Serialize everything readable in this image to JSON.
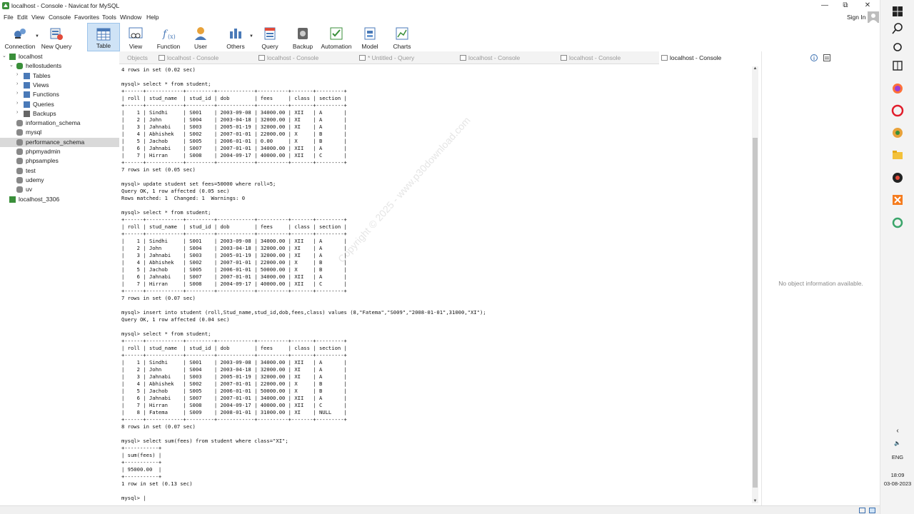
{
  "window": {
    "title": "localhost - Console - Navicat for MySQL"
  },
  "menu": {
    "items": [
      "File",
      "Edit",
      "View",
      "Console",
      "Favorites",
      "Tools",
      "Window",
      "Help"
    ],
    "sign_in": "Sign In"
  },
  "toolbar": {
    "items": [
      "Connection",
      "New Query",
      "Table",
      "View",
      "Function",
      "User",
      "Others",
      "Query",
      "Backup",
      "Automation",
      "Model",
      "Charts"
    ],
    "active": "Table"
  },
  "sidebar": {
    "items": [
      {
        "label": "localhost",
        "icon": "connection-icon"
      },
      {
        "label": "hellostudents",
        "icon": "database-icon"
      },
      {
        "label": "Tables",
        "icon": "table-icon"
      },
      {
        "label": "Views",
        "icon": "view-icon"
      },
      {
        "label": "Functions",
        "icon": "function-icon"
      },
      {
        "label": "Queries",
        "icon": "query-icon"
      },
      {
        "label": "Backups",
        "icon": "backup-icon"
      },
      {
        "label": "information_schema",
        "icon": "database-icon"
      },
      {
        "label": "mysql",
        "icon": "database-icon"
      },
      {
        "label": "performance_schema",
        "icon": "database-icon"
      },
      {
        "label": "phpmyadmin",
        "icon": "database-icon"
      },
      {
        "label": "phpsamples",
        "icon": "database-icon"
      },
      {
        "label": "test",
        "icon": "database-icon"
      },
      {
        "label": "udemy",
        "icon": "database-icon"
      },
      {
        "label": "uv",
        "icon": "database-icon"
      },
      {
        "label": "localhost_3306",
        "icon": "connection-icon"
      }
    ],
    "selected": "performance_schema"
  },
  "tabs": [
    "Objects",
    "localhost - Console",
    "localhost - Console",
    "* Untitled - Query",
    "localhost - Console",
    "localhost - Console",
    "localhost - Console"
  ],
  "console": {
    "text": "4 rows in set (0.02 sec)\n\nmysql> select * from student;\n+------+------------+---------+------------+----------+-------+---------+\n| roll | stud_name  | stud_id | dob        | fees     | class | section |\n+------+------------+---------+------------+----------+-------+---------+\n|    1 | Sindhi     | S001    | 2003-09-08 | 34000.00 | XII   | A       |\n|    2 | John       | S004    | 2003-04-18 | 32000.00 | XI    | A       |\n|    3 | Jahnabi    | S003    | 2005-01-19 | 32000.00 | XI    | A       |\n|    4 | Abhishek   | S002    | 2007-01-01 | 22000.00 | X     | B       |\n|    5 | Jachob     | S005    | 2006-01-01 | 0.00     | X     | B       |\n|    6 | Jahnabi    | S007    | 2007-01-01 | 34000.00 | XII   | A       |\n|    7 | Hirran     | S008    | 2004-09-17 | 40000.00 | XII   | C       |\n+------+------------+---------+------------+----------+-------+---------+\n7 rows in set (0.05 sec)\n\nmysql> update student set fees=50000 where roll=5;\nQuery OK, 1 row affected (0.05 sec)\nRows matched: 1  Changed: 1  Warnings: 0\n\nmysql> select * from student;\n+------+------------+---------+------------+----------+-------+---------+\n| roll | stud_name  | stud_id | dob        | fees     | class | section |\n+------+------------+---------+------------+----------+-------+---------+\n|    1 | Sindhi     | S001    | 2003-09-08 | 34000.00 | XII   | A       |\n|    2 | John       | S004    | 2003-04-18 | 32000.00 | XI    | A       |\n|    3 | Jahnabi    | S003    | 2005-01-19 | 32000.00 | XI    | A       |\n|    4 | Abhishek   | S002    | 2007-01-01 | 22000.00 | X     | B       |\n|    5 | Jachob     | S005    | 2006-01-01 | 50000.00 | X     | B       |\n|    6 | Jahnabi    | S007    | 2007-01-01 | 34000.00 | XII   | A       |\n|    7 | Hirran     | S008    | 2004-09-17 | 40000.00 | XII   | C       |\n+------+------------+---------+------------+----------+-------+---------+\n7 rows in set (0.07 sec)\n\nmysql> insert into student (roll,Stud_name,stud_id,dob,fees,class) values (8,\"Fatema\",\"S009\",\"2008-01-01\",31000,\"XI\");\nQuery OK, 1 row affected (0.04 sec)\n\nmysql> select * from student;\n+------+------------+---------+------------+----------+-------+---------+\n| roll | stud_name  | stud_id | dob        | fees     | class | section |\n+------+------------+---------+------------+----------+-------+---------+\n|    1 | Sindhi     | S001    | 2003-09-08 | 34000.00 | XII   | A       |\n|    2 | John       | S004    | 2003-04-18 | 32000.00 | XI    | A       |\n|    3 | Jahnabi    | S003    | 2005-01-19 | 32000.00 | XI    | A       |\n|    4 | Abhishek   | S002    | 2007-01-01 | 22000.00 | X     | B       |\n|    5 | Jachob     | S005    | 2006-01-01 | 50000.00 | X     | B       |\n|    6 | Jahnabi    | S007    | 2007-01-01 | 34000.00 | XII   | A       |\n|    7 | Hirran     | S008    | 2004-09-17 | 40000.00 | XII   | C       |\n|    8 | Fatema     | S009    | 2008-01-01 | 31000.00 | XI    | NULL    |\n+------+------------+---------+------------+----------+-------+---------+\n8 rows in set (0.07 sec)\n\nmysql> select sum(fees) from student where class=\"XI\";\n+-----------+\n| sum(fees) |\n+-----------+\n| 95000.00  |\n+-----------+\n1 row in set (0.13 sec)\n\nmysql> |"
  },
  "right_panel": {
    "message": "No object information available."
  },
  "watermark": "Copyright © 2025 - www.p30download.com",
  "system": {
    "lang": "ENG",
    "time": "18:09",
    "date": "03-08-2023"
  },
  "colors": {
    "active_tab": "#cfe3f6",
    "selected_tree": "#d9d9d9"
  }
}
